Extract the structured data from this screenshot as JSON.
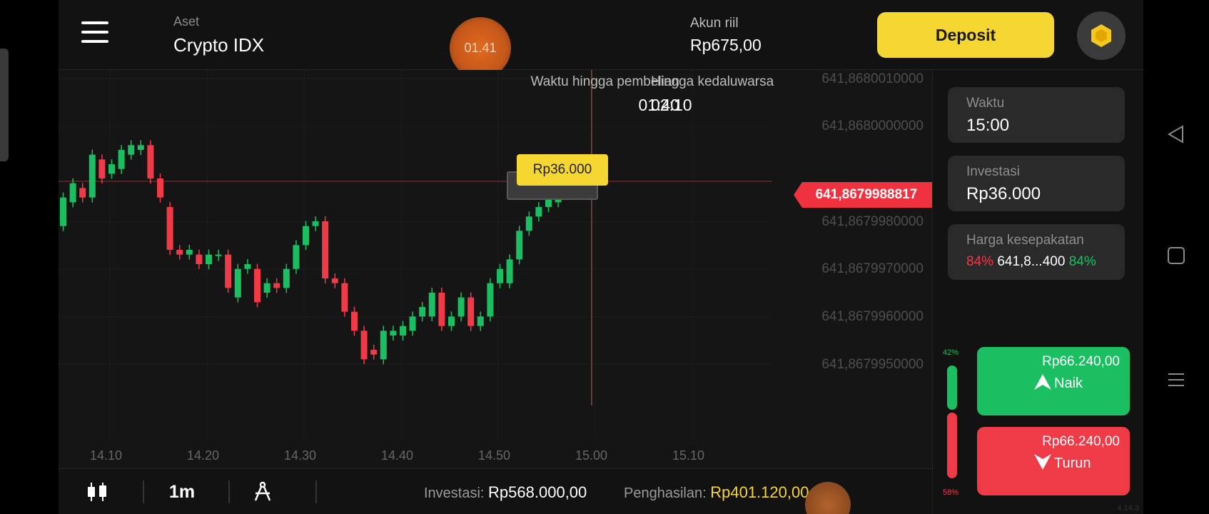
{
  "header": {
    "asset_label": "Aset",
    "asset_name": "Crypto IDX",
    "timer": "01.41",
    "account_label": "Akun riil",
    "account_balance": "Rp675,00",
    "deposit_label": "Deposit"
  },
  "chart": {
    "purchase_label": "Waktu hingga pembelian",
    "purchase_time": "01:40",
    "expiry_label": "Hingga kedaluwarsa",
    "expiry_time": "02:10",
    "current_price": "641,8679988817",
    "bet_marker": "Rp36.000"
  },
  "chart_data": {
    "type": "candlestick",
    "asset": "Crypto IDX",
    "y_ticks": [
      "641,8680010000",
      "641,8680000000",
      "641,8679980000",
      "641,8679970000",
      "641,8679960000",
      "641,8679950000"
    ],
    "x_ticks": [
      "14.10",
      "14.20",
      "14.30",
      "14.40",
      "14.50",
      "15.00",
      "15.10"
    ],
    "current_price": "641,8679988817",
    "colors": {
      "up": "#1bbf62",
      "down": "#ef3b48"
    },
    "candles": [
      {
        "d": "up",
        "o": 641.8679979,
        "c": 641.8679985
      },
      {
        "d": "up",
        "o": 641.8679984,
        "c": 641.8679988
      },
      {
        "d": "down",
        "o": 641.8679987,
        "c": 641.8679985
      },
      {
        "d": "up",
        "o": 641.8679985,
        "c": 641.8679994
      },
      {
        "d": "down",
        "o": 641.8679993,
        "c": 641.8679989
      },
      {
        "d": "up",
        "o": 641.867999,
        "c": 641.8679992
      },
      {
        "d": "up",
        "o": 641.8679991,
        "c": 641.8679995
      },
      {
        "d": "up",
        "o": 641.8679994,
        "c": 641.8679996
      },
      {
        "d": "up",
        "o": 641.8679995,
        "c": 641.8679996
      },
      {
        "d": "down",
        "o": 641.8679996,
        "c": 641.8679989
      },
      {
        "d": "down",
        "o": 641.8679989,
        "c": 641.8679985
      },
      {
        "d": "down",
        "o": 641.8679983,
        "c": 641.8679974
      },
      {
        "d": "down",
        "o": 641.8679974,
        "c": 641.8679973
      },
      {
        "d": "up",
        "o": 641.8679973,
        "c": 641.8679974
      },
      {
        "d": "down",
        "o": 641.8679973,
        "c": 641.8679971
      },
      {
        "d": "up",
        "o": 641.8679971,
        "c": 641.8679973
      },
      {
        "d": "up",
        "o": 641.8679973,
        "c": 641.8679973
      },
      {
        "d": "down",
        "o": 641.8679973,
        "c": 641.8679966
      },
      {
        "d": "up",
        "o": 641.8679964,
        "c": 641.867997
      },
      {
        "d": "up",
        "o": 641.867997,
        "c": 641.8679971
      },
      {
        "d": "down",
        "o": 641.867997,
        "c": 641.8679963
      },
      {
        "d": "up",
        "o": 641.8679965,
        "c": 641.8679967
      },
      {
        "d": "down",
        "o": 641.8679967,
        "c": 641.8679966
      },
      {
        "d": "up",
        "o": 641.8679966,
        "c": 641.867997
      },
      {
        "d": "up",
        "o": 641.867997,
        "c": 641.8679975
      },
      {
        "d": "up",
        "o": 641.8679975,
        "c": 641.8679979
      },
      {
        "d": "up",
        "o": 641.8679979,
        "c": 641.867998
      },
      {
        "d": "down",
        "o": 641.867998,
        "c": 641.8679968
      },
      {
        "d": "down",
        "o": 641.8679968,
        "c": 641.8679967
      },
      {
        "d": "down",
        "o": 641.8679967,
        "c": 641.8679961
      },
      {
        "d": "down",
        "o": 641.8679961,
        "c": 641.8679957
      },
      {
        "d": "down",
        "o": 641.8679957,
        "c": 641.8679951
      },
      {
        "d": "down",
        "o": 641.8679953,
        "c": 641.8679952
      },
      {
        "d": "up",
        "o": 641.8679951,
        "c": 641.8679957
      },
      {
        "d": "up",
        "o": 641.8679956,
        "c": 641.8679957
      },
      {
        "d": "up",
        "o": 641.8679956,
        "c": 641.8679958
      },
      {
        "d": "up",
        "o": 641.8679957,
        "c": 641.867996
      },
      {
        "d": "up",
        "o": 641.867996,
        "c": 641.8679962
      },
      {
        "d": "up",
        "o": 641.867996,
        "c": 641.8679965
      },
      {
        "d": "down",
        "o": 641.8679965,
        "c": 641.8679958
      },
      {
        "d": "up",
        "o": 641.8679958,
        "c": 641.867996
      },
      {
        "d": "up",
        "o": 641.867996,
        "c": 641.8679964
      },
      {
        "d": "down",
        "o": 641.8679964,
        "c": 641.8679958
      },
      {
        "d": "up",
        "o": 641.8679958,
        "c": 641.867996
      },
      {
        "d": "up",
        "o": 641.867996,
        "c": 641.8679967
      },
      {
        "d": "up",
        "o": 641.8679967,
        "c": 641.867997
      },
      {
        "d": "up",
        "o": 641.8679967,
        "c": 641.8679972
      },
      {
        "d": "up",
        "o": 641.8679972,
        "c": 641.8679978
      },
      {
        "d": "up",
        "o": 641.8679978,
        "c": 641.8679981
      },
      {
        "d": "up",
        "o": 641.8679981,
        "c": 641.8679983
      },
      {
        "d": "up",
        "o": 641.8679983,
        "c": 641.8679985
      },
      {
        "d": "up",
        "o": 641.8679984,
        "c": 641.8679986
      },
      {
        "d": "up",
        "o": 641.8679986,
        "c": 641.8679988
      }
    ]
  },
  "panel": {
    "time_label": "Waktu",
    "time_value": "15:00",
    "invest_label": "Investasi",
    "invest_value": "Rp36.000",
    "strike_label": "Harga kesepakatan",
    "strike_left_pct": "84%",
    "strike_value": "641,8...400",
    "strike_right_pct": "84%",
    "sentiment_up": "42%",
    "sentiment_down": "58%",
    "naik_amount": "Rp66.240,00",
    "naik_label": "Naik",
    "turun_amount": "Rp66.240,00",
    "turun_label": "Turun",
    "version": "4.14.3"
  },
  "bottom": {
    "timeframe": "1m",
    "invest_label": "Investasi:",
    "invest_value": "Rp568.000,00",
    "income_label": "Penghasilan:",
    "income_value": "Rp401.120,00"
  },
  "icons": [
    "menu-icon",
    "crypto-avatar-icon",
    "candles-icon",
    "drawing-tool-icon",
    "arrow-up-icon",
    "arrow-down-icon",
    "back-icon",
    "home-icon",
    "recents-icon"
  ]
}
